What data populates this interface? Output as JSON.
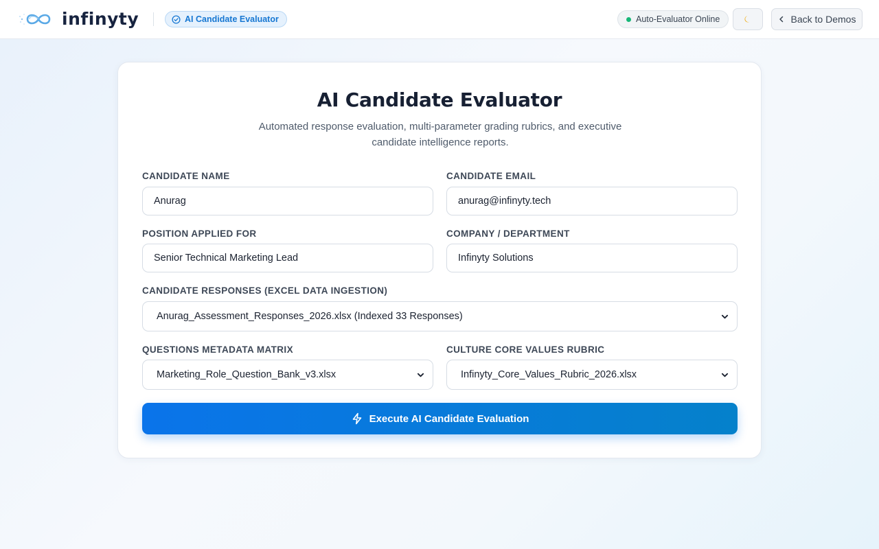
{
  "header": {
    "brand": "infinyty",
    "product_badge": "AI Candidate Evaluator",
    "status_text": "Auto-Evaluator Online",
    "theme_icon": "moon-icon",
    "back_label": "Back to Demos"
  },
  "main": {
    "title": "AI Candidate Evaluator",
    "subtitle": "Automated response evaluation, multi-parameter grading rubrics, and executive candidate intelligence reports."
  },
  "form": {
    "candidate_name": {
      "label": "CANDIDATE NAME",
      "value": "Anurag"
    },
    "candidate_email": {
      "label": "CANDIDATE EMAIL",
      "value": "anurag@infinyty.tech"
    },
    "position": {
      "label": "POSITION APPLIED FOR",
      "value": "Senior Technical Marketing Lead"
    },
    "company": {
      "label": "COMPANY / DEPARTMENT",
      "value": "Infinyty Solutions"
    },
    "responses": {
      "label": "CANDIDATE RESPONSES (EXCEL DATA INGESTION)",
      "selected": "Anurag_Assessment_Responses_2026.xlsx (Indexed 33 Responses)"
    },
    "questions": {
      "label": "QUESTIONS METADATA MATRIX",
      "selected": "Marketing_Role_Question_Bank_v3.xlsx"
    },
    "culture": {
      "label": "CULTURE CORE VALUES RUBRIC",
      "selected": "Infinyty_Core_Values_Rubric_2026.xlsx"
    },
    "submit_label": "Execute AI Candidate Evaluation"
  },
  "colors": {
    "accent": "#0a74ea",
    "status_online": "#16b777",
    "badge_text": "#1677d2"
  }
}
